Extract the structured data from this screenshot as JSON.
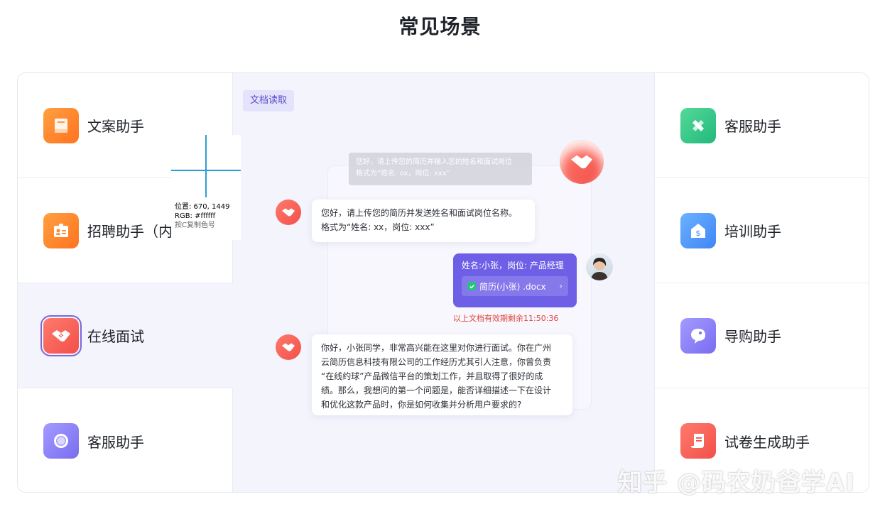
{
  "page": {
    "title": "常见场景"
  },
  "left_cards": [
    {
      "label": "文案助手",
      "icon": "document-icon",
      "color": "#ff7f2c"
    },
    {
      "label": "招聘助手（内",
      "icon": "id-card-icon",
      "color": "#ff7f2c"
    },
    {
      "label": "在线面试",
      "icon": "handshake-icon",
      "color": "#f2504a",
      "active": true
    },
    {
      "label": "客服助手",
      "icon": "ring-icon",
      "color": "#7a6cf0"
    }
  ],
  "right_cards": [
    {
      "label": "客服助手",
      "icon": "tools-icon",
      "color": "#22b97a"
    },
    {
      "label": "培训助手",
      "icon": "dollar-house-icon",
      "color": "#3e86f5"
    },
    {
      "label": "导购助手",
      "icon": "chat-bubble-icon",
      "color": "#7a6cf0"
    },
    {
      "label": "试卷生成助手",
      "icon": "exam-paper-icon",
      "color": "#f2504a"
    }
  ],
  "chat": {
    "tag": "文档读取",
    "ghost_message": {
      "line1": "您好，请上传您的简历并输入您的姓名和面试岗位",
      "line2": "格式为“姓名: ox，岗位: xxx”"
    },
    "bot_message_1": {
      "line1": "您好，请上传您的简历并发送姓名和面试岗位名称。",
      "line2": "格式为“姓名: xx，岗位: xxx”"
    },
    "user_message": "姓名:小张，岗位: 产品经理",
    "attachment": "简历(小张) .docx",
    "expire_note": "以上文档有效期剩余11:50:36",
    "bot_message_2": {
      "line1": "你好，小张同学，非常高兴能在这里对你进行面试。你在广州",
      "line2": "云简历信息科技有限公司的工作经历尤其引人注意，你曾负责",
      "line3": "“在线约球”产品微信平台的策划工作，并且取得了很好的成",
      "line4": "绩。那么，我想问的第一个问题是，能否详细描述一下在设计",
      "line5": "和优化这款产品时，你是如何收集并分析用户要求的?"
    }
  },
  "color_picker": {
    "position": "位置: 670, 1449",
    "rgb": "RGB: #ffffff",
    "hint": "按C复制色号"
  },
  "watermark": "知乎 @码农奶爸学AI",
  "colors": {
    "accent": "#6d5fe6",
    "bot": "#f2504a",
    "panel_bg": "#f4f4fd",
    "expire": "#e0453c"
  }
}
